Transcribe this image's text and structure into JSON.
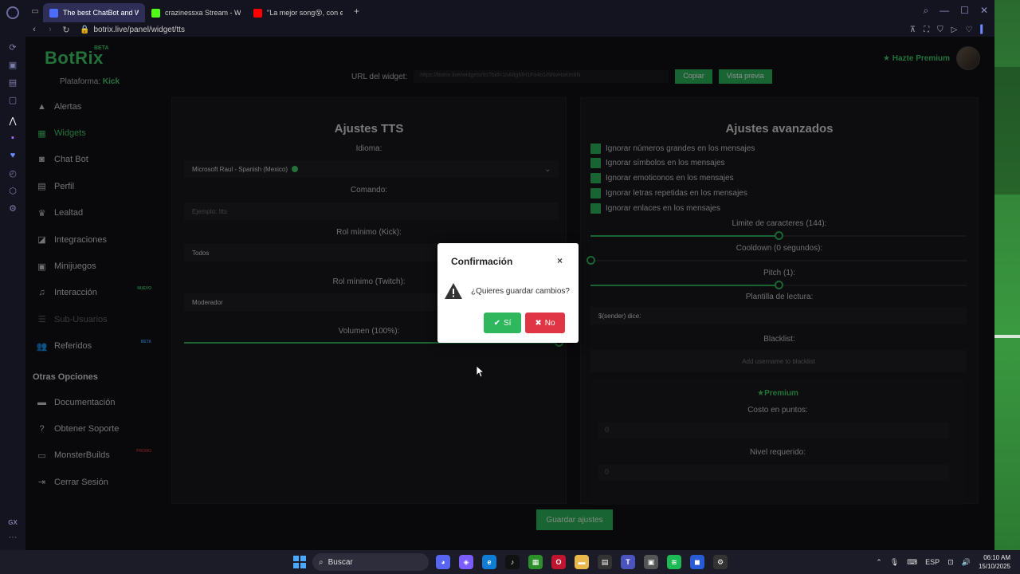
{
  "browser": {
    "tabs": [
      {
        "title": "The best ChatBot and Wi",
        "active": true,
        "favicon_color": "#4a6cff"
      },
      {
        "title": "crazinessxa Stream - Wat",
        "active": false,
        "favicon_color": "#53fc18"
      },
      {
        "title": "\"La mejor song😵, con est",
        "active": false,
        "favicon_color": "#ff0000"
      }
    ],
    "url": "botrix.live/panel/widget/tts"
  },
  "brand": {
    "name": "BotRix",
    "badge": "BETA"
  },
  "platform": {
    "label": "Plataforma:",
    "value": "Kick"
  },
  "sidebar": {
    "items": [
      {
        "label": "Alertas",
        "icon": "warning-icon",
        "state": "normal",
        "badge": ""
      },
      {
        "label": "Widgets",
        "icon": "widgets-icon",
        "state": "active",
        "badge": ""
      },
      {
        "label": "Chat Bot",
        "icon": "robot-icon",
        "state": "normal",
        "badge": ""
      },
      {
        "label": "Perfil",
        "icon": "id-card-icon",
        "state": "normal",
        "badge": ""
      },
      {
        "label": "Lealtad",
        "icon": "trophy-icon",
        "state": "normal",
        "badge": ""
      },
      {
        "label": "Integraciones",
        "icon": "integrations-icon",
        "state": "normal",
        "badge": ""
      },
      {
        "label": "Minijuegos",
        "icon": "games-icon",
        "state": "normal",
        "badge": ""
      },
      {
        "label": "Interacción",
        "icon": "music-icon",
        "state": "normal",
        "badge": "NUEVO"
      },
      {
        "label": "Sub-Usuarios",
        "icon": "users-icon",
        "state": "disabled",
        "badge": ""
      },
      {
        "label": "Referidos",
        "icon": "referrals-icon",
        "state": "normal",
        "badge": "BETA"
      }
    ],
    "other_title": "Otras Opciones",
    "other_items": [
      {
        "label": "Documentación",
        "icon": "docs-icon"
      },
      {
        "label": "Obtener Soporte",
        "icon": "help-icon"
      },
      {
        "label": "MonsterBuilds",
        "icon": "monitor-icon",
        "badge": "PROMO"
      },
      {
        "label": "Cerrar Sesión",
        "icon": "logout-icon"
      }
    ]
  },
  "topbar": {
    "premium": "Hazte Premium"
  },
  "widget_url": {
    "label": "URL del widget:",
    "value": "https://botrix.live/widgets/tts?bid=1nA8gMH1Fo4o1iNNvHaKm8N",
    "copy": "Copiar",
    "preview": "Vista previa"
  },
  "tts": {
    "title": "Ajustes TTS",
    "language_label": "Idioma:",
    "language_value": "Microsoft Raul - Spanish (Mexico)",
    "command_label": "Comando:",
    "command_placeholder": "Ejemplo: !tts",
    "kick_role_label": "Rol mínimo (Kick):",
    "kick_role_value": "Todos",
    "twitch_role_label": "Rol mínimo (Twitch):",
    "twitch_role_value": "Moderador",
    "volume_label": "Volumen (100%):",
    "volume_level": 100
  },
  "advanced": {
    "title": "Ajustes avanzados",
    "checkboxes": [
      "Ignorar números grandes en los mensajes",
      "Ignorar símbolos en los mensajes",
      "Ignorar emoticonos en los mensajes",
      "Ignorar letras repetidas en los mensajes",
      "Ignorar enlaces en los mensajes"
    ],
    "char_limit_label": "Limite de caracteres (144):",
    "char_limit_level": 0.5,
    "cooldown_label": "Cooldown (0 segundos):",
    "cooldown_level": 0,
    "pitch_label": "Pitch (1):",
    "pitch_level": 0.5,
    "template_label": "Plantilla de lectura:",
    "template_value": "$(sender) dice:",
    "blacklist_label": "Blacklist:",
    "blacklist_placeholder": "Add username to blacklist",
    "premium_title": "Premium",
    "points_label": "Costo en puntos:",
    "points_value": "0",
    "level_label": "Nivel requerido:",
    "level_value": "0"
  },
  "save_button": "Guardar ajustes",
  "modal": {
    "title": "Confirmación",
    "close": "×",
    "message": "¿Quieres guardar cambios?",
    "yes": "Sí",
    "no": "No"
  },
  "taskbar": {
    "search": "Buscar",
    "lang": "ESP",
    "time": "06:10 AM",
    "date": "15/10/2025"
  },
  "colors": {
    "accent": "#2fb75e",
    "brand": "#3fcf6b",
    "danger": "#e03545"
  }
}
